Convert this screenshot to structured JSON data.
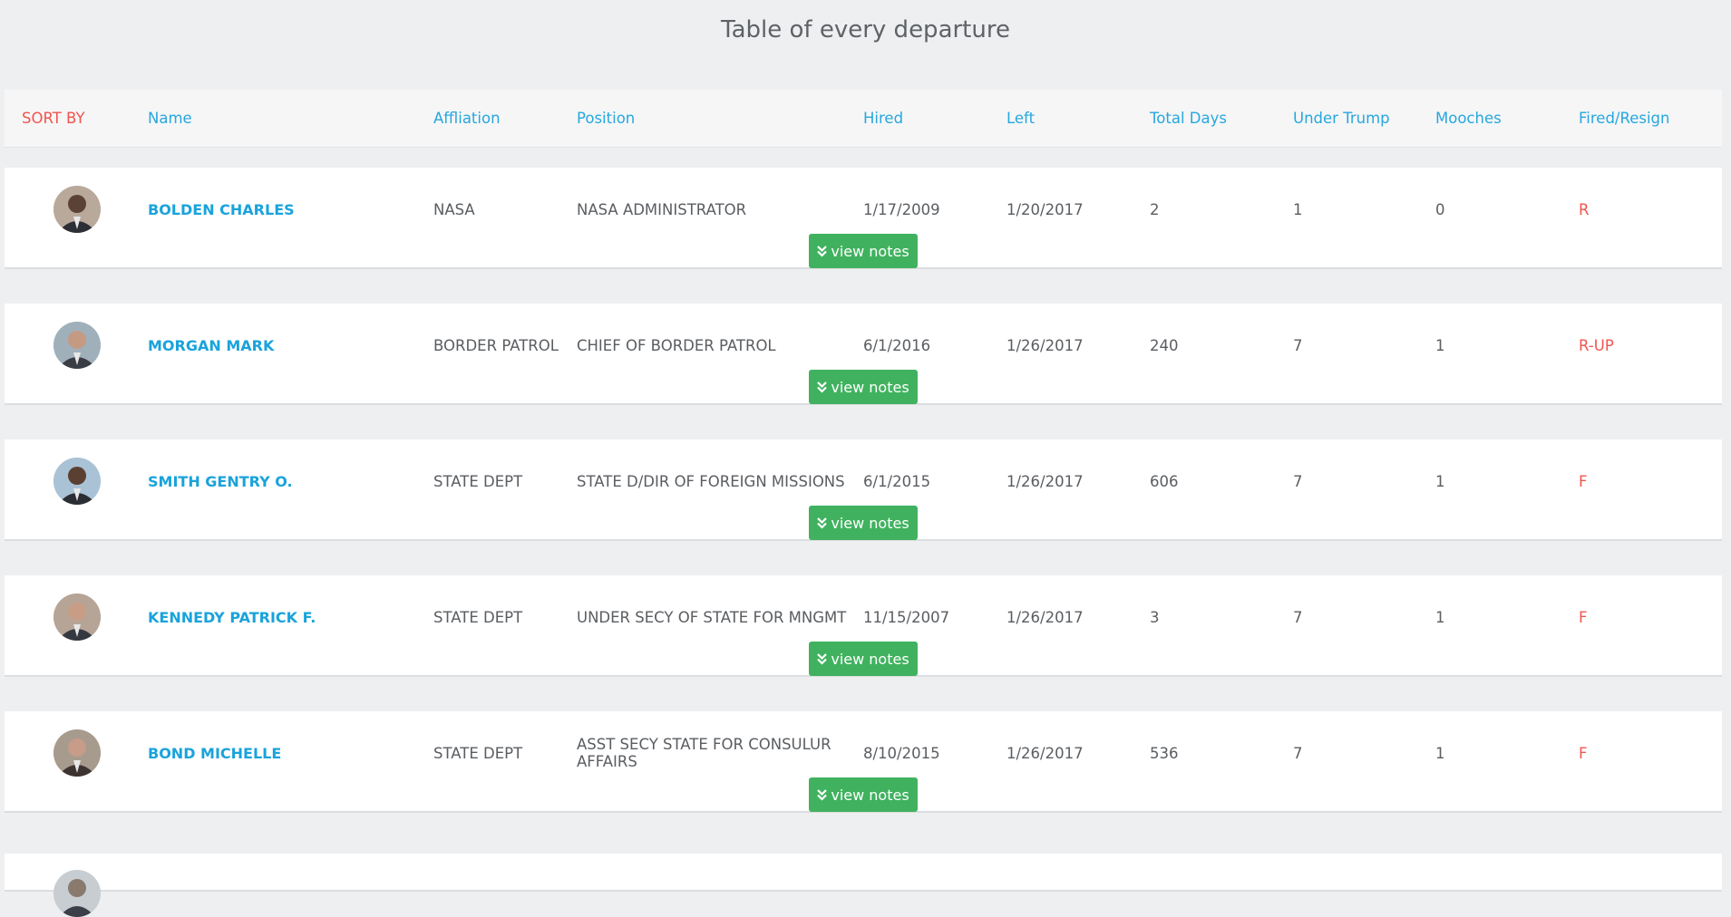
{
  "title": "Table of every departure",
  "header": {
    "sort_by": "SORT BY",
    "columns": {
      "name": "Name",
      "affiliation": "Affliation",
      "position": "Position",
      "hired": "Hired",
      "left": "Left",
      "total_days": "Total Days",
      "under_trump": "Under Trump",
      "mooches": "Mooches",
      "fired_resign": "Fired/Resign"
    }
  },
  "notes_button_label": "view notes",
  "notes_button_icon": "double-chevron-down-icon",
  "colors": {
    "link": "#27a7de",
    "name": "#1aa3db",
    "status": "#f2544d",
    "button": "#40b25f",
    "background": "#eeeff1"
  },
  "rows": [
    {
      "name": "BOLDEN CHARLES",
      "affiliation": "NASA",
      "position": "NASA ADMINISTRATOR",
      "hired": "1/17/2009",
      "left": "1/20/2017",
      "total_days": "2",
      "under_trump": "1",
      "mooches": "0",
      "fired_resign": "R"
    },
    {
      "name": "MORGAN MARK",
      "affiliation": "BORDER PATROL",
      "position": "CHIEF OF BORDER PATROL",
      "hired": "6/1/2016",
      "left": "1/26/2017",
      "total_days": "240",
      "under_trump": "7",
      "mooches": "1",
      "fired_resign": "R-UP"
    },
    {
      "name": "SMITH GENTRY O.",
      "affiliation": "STATE DEPT",
      "position": "STATE D/DIR OF FOREIGN MISSIONS",
      "hired": "6/1/2015",
      "left": "1/26/2017",
      "total_days": "606",
      "under_trump": "7",
      "mooches": "1",
      "fired_resign": "F"
    },
    {
      "name": "KENNEDY PATRICK F.",
      "affiliation": "STATE DEPT",
      "position": "UNDER SECY OF STATE FOR MNGMT",
      "hired": "11/15/2007",
      "left": "1/26/2017",
      "total_days": "3",
      "under_trump": "7",
      "mooches": "1",
      "fired_resign": "F"
    },
    {
      "name": "BOND MICHELLE",
      "affiliation": "STATE DEPT",
      "position": "ASST SECY STATE FOR CONSULUR AFFAIRS",
      "hired": "8/10/2015",
      "left": "1/26/2017",
      "total_days": "536",
      "under_trump": "7",
      "mooches": "1",
      "fired_resign": "F"
    }
  ]
}
